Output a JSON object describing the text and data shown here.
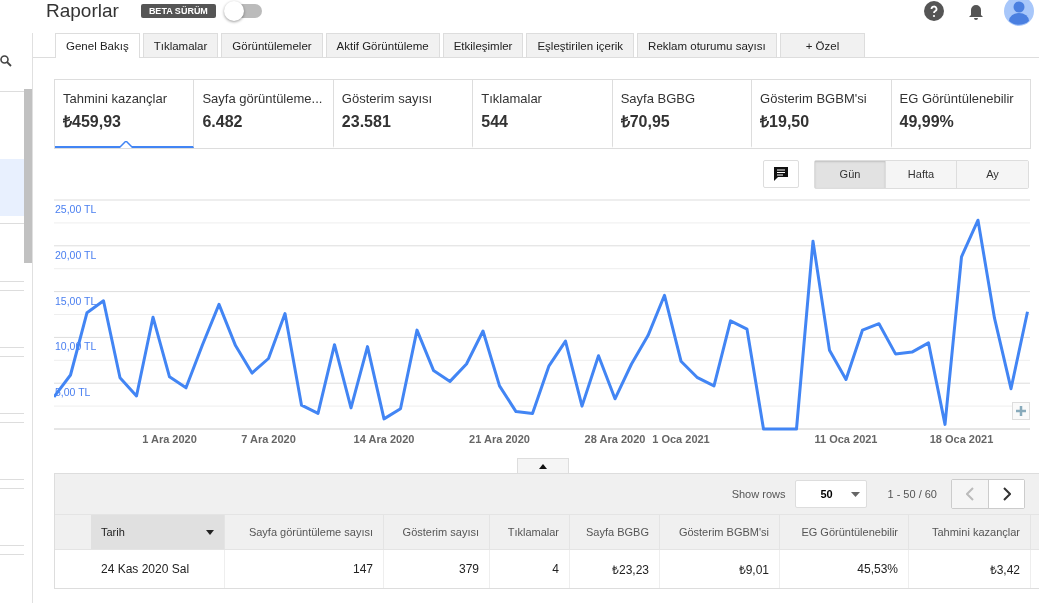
{
  "header": {
    "title": "Raporlar",
    "badge": "BETA SÜRÜM",
    "toggle": {
      "on": false
    }
  },
  "tabs": [
    {
      "label": "Genel Bakış",
      "selected": true
    },
    {
      "label": "Tıklamalar",
      "selected": false
    },
    {
      "label": "Görüntülemeler",
      "selected": false
    },
    {
      "label": "Aktif Görüntüleme",
      "selected": false
    },
    {
      "label": "Etkileşimler",
      "selected": false
    },
    {
      "label": "Eşleştirilen içerik",
      "selected": false
    },
    {
      "label": "Reklam oturumu sayısı",
      "selected": false
    },
    {
      "label": "+  Özel",
      "selected": false
    }
  ],
  "metrics": [
    {
      "label": "Tahmini kazançlar",
      "value": "₺459,93",
      "selected": true
    },
    {
      "label": "Sayfa görüntüleme...",
      "value": "6.482",
      "selected": false
    },
    {
      "label": "Gösterim sayısı",
      "value": "23.581",
      "selected": false
    },
    {
      "label": "Tıklamalar",
      "value": "544",
      "selected": false
    },
    {
      "label": "Sayfa BGBG",
      "value": "₺70,95",
      "selected": false
    },
    {
      "label": "Gösterim BGBM'si",
      "value": "₺19,50",
      "selected": false
    },
    {
      "label": "EG Görüntülenebilir",
      "value": "49,99%",
      "selected": false
    }
  ],
  "periods": [
    {
      "label": "Gün",
      "selected": true
    },
    {
      "label": "Hafta",
      "selected": false
    },
    {
      "label": "Ay",
      "selected": false
    }
  ],
  "chart_data": {
    "type": "line",
    "categories": [
      null,
      null,
      null,
      null,
      null,
      null,
      null,
      "1 Ara 2020",
      null,
      null,
      null,
      null,
      null,
      "7 Ara 2020",
      null,
      null,
      null,
      null,
      null,
      null,
      "14 Ara 2020",
      null,
      null,
      null,
      null,
      null,
      null,
      "21 Ara 2020",
      null,
      null,
      null,
      null,
      null,
      null,
      "28 Ara 2020",
      null,
      null,
      null,
      "1 Oca 2021",
      null,
      null,
      null,
      null,
      null,
      null,
      null,
      null,
      null,
      "11 Oca 2021",
      null,
      null,
      null,
      null,
      null,
      null,
      "18 Oca 2021",
      null,
      null,
      null,
      null
    ],
    "series": [
      {
        "color": "#4285f4",
        "values": [
          3.5,
          5.9,
          12.7,
          14.0,
          5.6,
          3.6,
          12.2,
          5.7,
          4.5,
          9.2,
          13.6,
          9.1,
          6.1,
          7.7,
          12.6,
          2.6,
          1.7,
          9.2,
          2.3,
          9.0,
          1.1,
          2.2,
          10.8,
          6.4,
          5.2,
          7.1,
          10.7,
          4.7,
          1.9,
          1.7,
          6.9,
          9.6,
          2.5,
          8.0,
          3.3,
          7.1,
          10.2,
          14.6,
          7.4,
          5.6,
          4.7,
          11.8,
          10.9,
          0,
          0,
          0,
          20.5,
          8.6,
          5.4,
          10.8,
          11.5,
          8.2,
          8.4,
          9.4,
          0.5,
          18.8,
          22.8,
          12.1,
          4.4,
          12.8
        ]
      }
    ],
    "ylim": [
      0,
      25
    ],
    "grid": true,
    "yticks": [
      {
        "value": 5,
        "label": "5,00 TL"
      },
      {
        "value": 10,
        "label": "10,00 TL"
      },
      {
        "value": 15,
        "label": "15,00 TL"
      },
      {
        "value": 20,
        "label": "20,00 TL"
      },
      {
        "value": 25,
        "label": "25,00 TL"
      }
    ]
  },
  "table": {
    "show_rows_label": "Show rows",
    "rows_per_page": "50",
    "range": "1 - 50 / 60",
    "columns": [
      {
        "label": "Tarih",
        "sorted": true
      },
      {
        "label": "Sayfa görüntüleme sayısı",
        "sorted": false
      },
      {
        "label": "Gösterim sayısı",
        "sorted": false
      },
      {
        "label": "Tıklamalar",
        "sorted": false
      },
      {
        "label": "Sayfa BGBG",
        "sorted": false
      },
      {
        "label": "Gösterim BGBM'si",
        "sorted": false
      },
      {
        "label": "EG Görüntülenebilir",
        "sorted": false
      },
      {
        "label": "Tahmini kazançlar",
        "sorted": false
      }
    ],
    "rows": [
      {
        "cells": [
          "24 Kas 2020 Sal",
          "147",
          "379",
          "4",
          "₺23,23",
          "₺9,01",
          "45,53%",
          "₺3,42"
        ]
      }
    ]
  }
}
